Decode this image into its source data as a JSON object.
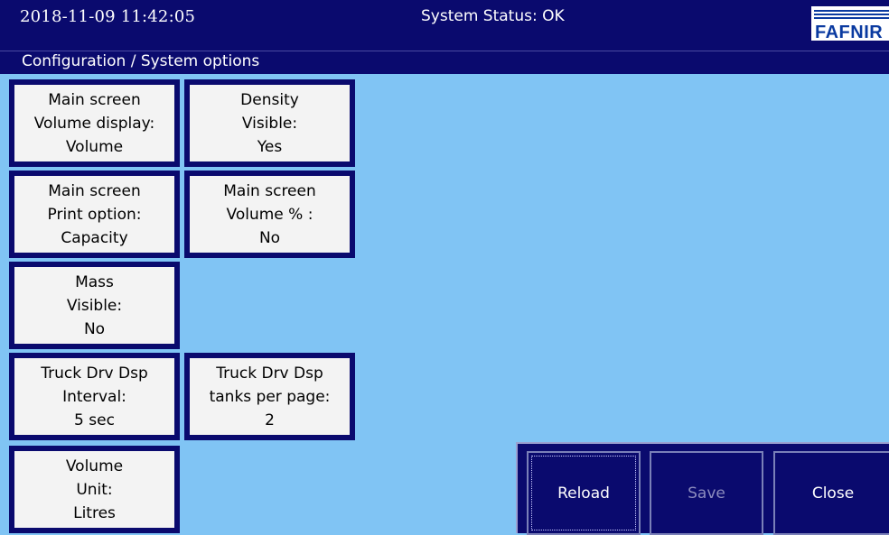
{
  "header": {
    "datetime": "2018-11-09  11:42:05",
    "status": "System Status: OK",
    "logo_text": "FAFNIR"
  },
  "breadcrumb": "Configuration / System options",
  "options": [
    {
      "line1": "Main screen",
      "line2": "Volume display:",
      "value": "Volume"
    },
    {
      "line1": "Density",
      "line2": "Visible:",
      "value": "Yes"
    },
    {
      "line1": "Main screen",
      "line2": "Print option:",
      "value": "Capacity"
    },
    {
      "line1": "Main screen",
      "line2": "Volume % :",
      "value": "No"
    },
    {
      "line1": "Mass",
      "line2": "Visible:",
      "value": "No"
    },
    {
      "line1": "Truck Drv Dsp",
      "line2": "Interval:",
      "value": "5 sec"
    },
    {
      "line1": "Truck Drv Dsp",
      "line2": "tanks per page:",
      "value": "2"
    },
    {
      "line1": "Volume",
      "line2": "Unit:",
      "value": "Litres"
    }
  ],
  "buttons": {
    "reload": "Reload",
    "save": "Save",
    "close": "Close"
  },
  "colors": {
    "background": "#80c4f4",
    "bar": "#0a0a6e",
    "tile": "#f3f3f3",
    "disabled_text": "#8c8cbe"
  }
}
